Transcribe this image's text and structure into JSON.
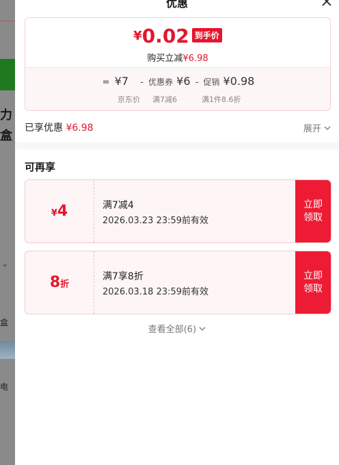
{
  "header": {
    "title": "优惠"
  },
  "price": {
    "currency": "¥",
    "amount": "0.02",
    "badge": "到手价",
    "save_label": "购买立减",
    "save_amount": "¥6.98"
  },
  "formula": {
    "eq": "=",
    "base": "¥7",
    "minus1": "-",
    "coupon_label": "优惠券",
    "coupon_value": "¥6",
    "minus2": "-",
    "promo_label": "促销",
    "promo_value": "¥0.98",
    "base_caption": "京东价",
    "coupon_caption": "满7减6",
    "promo_caption": "满1件8.6折"
  },
  "enjoyed": {
    "label": "已享优惠",
    "amount": "¥6.98",
    "expand": "展开"
  },
  "more": {
    "title": "可再享",
    "coupons": [
      {
        "value_prefix": "¥",
        "value": "4",
        "value_suffix": "",
        "desc": "满7减4",
        "valid": "2026.03.23 23:59前有效",
        "claim_1": "立即",
        "claim_2": "领取"
      },
      {
        "value_prefix": "",
        "value": "8",
        "value_suffix": "折",
        "desc": "满7享8折",
        "valid": "2026.03.18 23:59前有效",
        "claim_1": "立即",
        "claim_2": "领取"
      }
    ],
    "view_all": "查看全部(6)"
  },
  "background": {
    "text_1": "力",
    "text_2": "盒",
    "text_3": "盒",
    "text_4": "电"
  },
  "colors": {
    "accent": "#e4162c",
    "claim_bg": "#ee1b34",
    "card_bg": "#fef6f6"
  }
}
